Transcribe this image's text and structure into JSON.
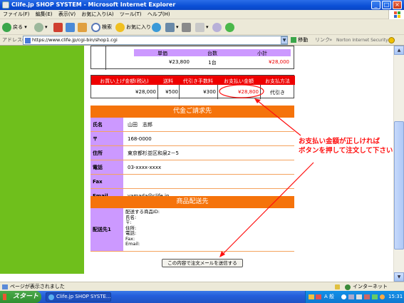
{
  "window": {
    "title": "Clife.jp SHOP SYSTEM - Microsoft Internet Explorer"
  },
  "menu": [
    "ファイル(F)",
    "編集(E)",
    "表示(V)",
    "お気に入り(A)",
    "ツール(T)",
    "ヘルプ(H)"
  ],
  "toolbar": {
    "back": "戻る",
    "search": "検索",
    "favorites": "お気に入り"
  },
  "address": {
    "label": "アドレス(D)",
    "url": "https://www.clife.jp/cgi-bin/shop1.cgi",
    "go": "移動",
    "links": "リンク",
    "norton": "Norton Internet Security"
  },
  "product": {
    "headers": [
      "単価",
      "台数",
      "小計"
    ],
    "values": [
      "¥23,800",
      "1台",
      "¥28,000"
    ]
  },
  "totals": {
    "headers": [
      "お買い上げ金額(税込)",
      "送料",
      "代引き手数料",
      "お支払い金額",
      "お支払方法"
    ],
    "values": [
      "¥28,000",
      "¥500",
      "¥300",
      "¥28,800",
      "代引き"
    ]
  },
  "billing": {
    "title": "代金ご請求先",
    "rows": [
      {
        "label": "氏名",
        "value": "山田　志郎"
      },
      {
        "label": "〒",
        "value": "168-0000"
      },
      {
        "label": "住所",
        "value": "東京都杉並区和泉2－5"
      },
      {
        "label": "電話",
        "value": "03-xxxx-xxxx"
      },
      {
        "label": "Fax",
        "value": ""
      },
      {
        "label": "Email",
        "value": "yamada@clife.jp"
      }
    ]
  },
  "shipping": {
    "title": "商品配送先",
    "label": "配送先1",
    "lines": [
      "配送する商品ID:",
      "氏名:",
      "〒:",
      "住所:",
      "電話:",
      "Fax:",
      "Email:"
    ]
  },
  "submit": "この内容で注文メールを送信する",
  "callout": {
    "line1": "お支払い金額が正しければ",
    "line2": "ボタンを押して注文して下さい"
  },
  "status": {
    "text": "ページが表示されました",
    "zone": "インターネット"
  },
  "taskbar": {
    "start": "スタート",
    "task": "Clife.jp SHOP SYSTE...",
    "tray_text": "A 般",
    "clock": "15:31"
  },
  "colors": {
    "accent_red": "#ee0000",
    "orange": "#f5730b",
    "lavender": "#cc99ff",
    "green": "#6fbf1c"
  }
}
